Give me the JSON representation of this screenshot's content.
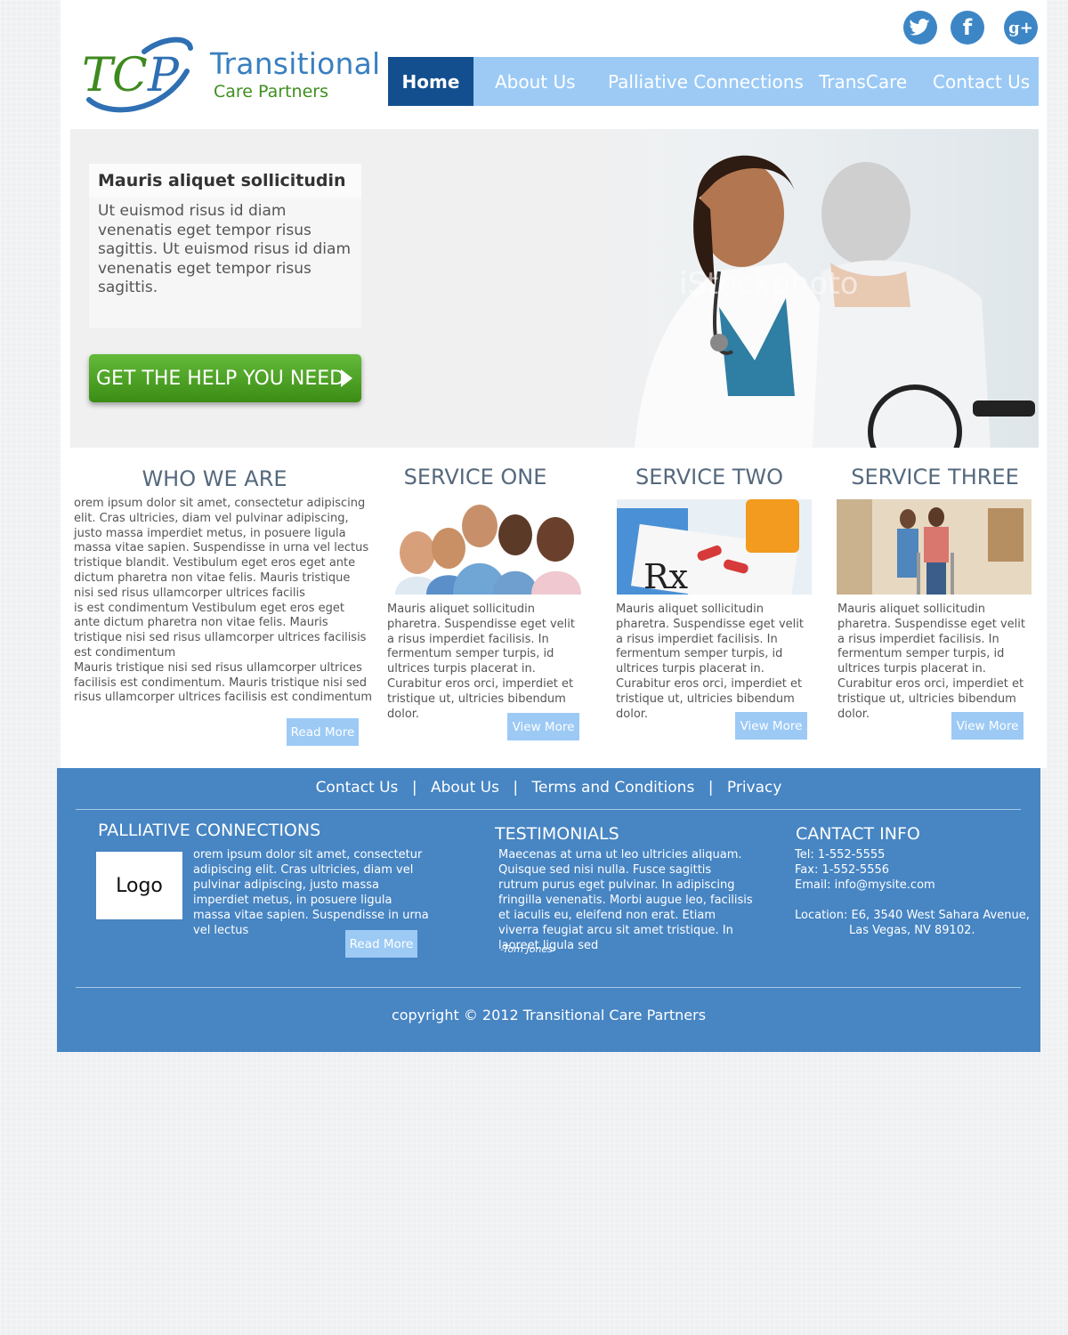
{
  "brand": {
    "logo_mark": "TCP",
    "title": "Transitional",
    "subtitle": "Care Partners"
  },
  "social": [
    {
      "icon": "twitter-icon",
      "glyph": "t"
    },
    {
      "icon": "facebook-icon",
      "glyph": "f"
    },
    {
      "icon": "google-plus-icon",
      "glyph": "g+"
    }
  ],
  "nav": {
    "items": [
      "Home",
      "About Us",
      "Palliative Connections",
      "TransCare",
      "Contact Us"
    ],
    "active": "Home"
  },
  "hero": {
    "card_title": "Mauris aliquet sollicitudin",
    "card_body": "Ut euismod risus id diam venenatis eget tempor risus sagittis. Ut euismod risus id diam venenatis eget tempor risus sagittis.",
    "cta_label": "GET THE HELP YOU NEED",
    "watermark": "iStockphoto"
  },
  "who_we_are": {
    "title": "WHO WE ARE",
    "paragraphs": [
      "orem ipsum dolor sit amet, consectetur adipiscing elit. Cras ultricies, diam vel pulvinar adipiscing, justo massa imperdiet metus, in posuere ligula massa vitae sapien. Suspendisse in urna vel lectus tristique blandit. Vestibulum eget eros eget ante dictum pharetra non vitae felis. Mauris tristique nisi sed risus ullamcorper ultrices facilis",
      "is est condimentum Vestibulum eget eros eget ante dictum pharetra non vitae felis. Mauris tristique nisi sed risus ullamcorper ultrices facilisis est condimentum",
      "Mauris tristique nisi sed risus ullamcorper ultrices facilisis est condimentum. Mauris tristique nisi sed risus ullamcorper ultrices facilisis est condimentum"
    ],
    "button": "Read More"
  },
  "services": [
    {
      "title": "SERVICE ONE",
      "text": "Mauris aliquet sollicitudin pharetra. Suspendisse eget velit a risus imperdiet facilisis. In fermentum semper turpis, id ultrices turpis placerat in. Curabitur eros orci, imperdiet et tristique ut, ultricies bibendum dolor.",
      "button": "View More"
    },
    {
      "title": "SERVICE TWO",
      "text": "Mauris aliquet sollicitudin pharetra. Suspendisse eget velit a risus imperdiet facilisis. In fermentum semper turpis, id ultrices turpis placerat in. Curabitur eros orci, imperdiet et tristique ut, ultricies bibendum dolor.",
      "button": "View More"
    },
    {
      "title": "SERVICE THREE",
      "text": "Mauris aliquet sollicitudin pharetra. Suspendisse eget velit a risus imperdiet facilisis. In fermentum semper turpis, id ultrices turpis placerat in. Curabitur eros orci, imperdiet et tristique ut, ultricies bibendum dolor.",
      "button": "View More"
    }
  ],
  "footer": {
    "links": [
      "Contact Us",
      "About Us",
      "Terms and Conditions",
      "Privacy"
    ],
    "separator": "|",
    "palliative": {
      "title": "PALLIATIVE CONNECTIONS",
      "logo_label": "Logo",
      "text": "orem ipsum dolor sit amet, consectetur adipiscing elit. Cras ultricies, diam vel pulvinar adipiscing, justo massa imperdiet metus, in posuere ligula massa vitae sapien. Suspendisse in urna vel lectus",
      "button": "Read More"
    },
    "testimonials": {
      "title": "TESTIMONIALS",
      "text": "Maecenas at urna ut leo ultricies aliquam. Quisque sed nisi nulla. Fusce sagittis rutrum purus eget pulvinar. In adipiscing fringilla venenatis. Morbi augue leo, facilisis et iaculis eu, eleifend non erat. Etiam viverra feugiat arcu sit amet tristique. In laoreet ligula sed",
      "author": "-Tom Jones-"
    },
    "contact": {
      "title": "CANTACT INFO",
      "tel": "Tel: 1-552-5555",
      "fax": "Fax: 1-552-5556",
      "email": "Email: info@mysite.com",
      "location_1": "Location: E6, 3540 West Sahara Avenue,",
      "location_2": "Las Vegas, NV 89102."
    },
    "copyright": "copyright © 2012 Transitional Care Partners"
  },
  "colors": {
    "nav_bg": "#9ccaf5",
    "nav_active": "#134f8e",
    "footer_bg": "#4785c3",
    "cta_green": "#4ea527",
    "brand_blue": "#3a7fc0",
    "brand_green": "#3f8f1f"
  }
}
